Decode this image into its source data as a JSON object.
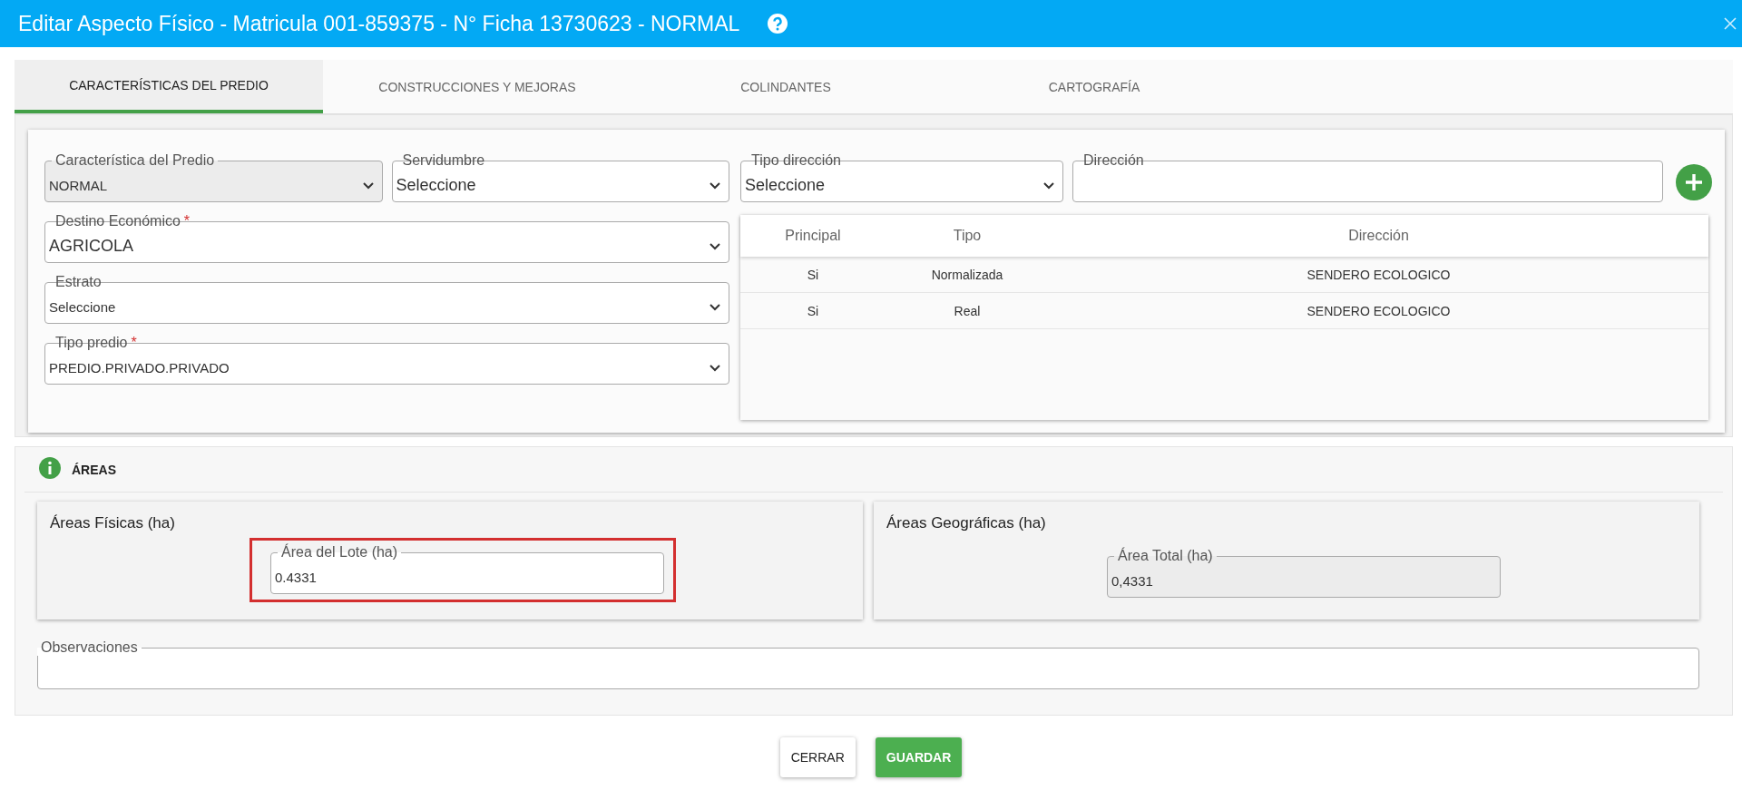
{
  "window": {
    "title": "Editar Aspecto Físico - Matricula 001-859375 - N° Ficha 13730623 - NORMAL"
  },
  "tabs": [
    {
      "label": "CARACTERÍSTICAS DEL PREDIO",
      "selected": true
    },
    {
      "label": "CONSTRUCCIONES Y MEJORAS",
      "selected": false
    },
    {
      "label": "COLINDANTES",
      "selected": false
    },
    {
      "label": "CARTOGRAFÍA",
      "selected": false
    }
  ],
  "left_fields": [
    {
      "label": "Característica del Predio",
      "value": "NORMAL",
      "disabled": true
    },
    {
      "label": "Servidumbre",
      "value": "Seleccione",
      "disabled": false
    },
    {
      "label": "Destino Económico",
      "required_mark": "*",
      "value": "AGRICOLA",
      "disabled": false
    },
    {
      "label": "Estrato",
      "value": "Seleccione",
      "disabled": false
    },
    {
      "label": "Tipo predio",
      "required_mark": "*",
      "value": "PREDIO.PRIVADO.PRIVADO",
      "disabled": false
    }
  ],
  "address": {
    "type_field": {
      "label": "Tipo dirección",
      "value": "Seleccione"
    },
    "address_field": {
      "label": "Dirección"
    },
    "table": {
      "columns": [
        "Principal",
        "Tipo",
        "Dirección"
      ],
      "rows": [
        [
          "Si",
          "Normalizada",
          "SENDERO ECOLOGICO"
        ],
        [
          "Si",
          "Real",
          "SENDERO ECOLOGICO"
        ]
      ]
    }
  },
  "areas": {
    "title": "ÁREAS",
    "physical": {
      "title": "Áreas Físicas (ha)",
      "field": {
        "label": "Área del Lote (ha)",
        "value": "0.4331",
        "disabled": false,
        "highlighted": true
      }
    },
    "geographic": {
      "title": "Áreas Geográficas (ha)",
      "field": {
        "label": "Área Total (ha)",
        "value": "0,4331",
        "disabled": true
      }
    },
    "notes": {
      "label": "Observaciones"
    }
  },
  "buttons": [
    {
      "label": "CERRAR",
      "kind": "secondary"
    },
    {
      "label": "GUARDAR",
      "kind": "primary"
    }
  ]
}
